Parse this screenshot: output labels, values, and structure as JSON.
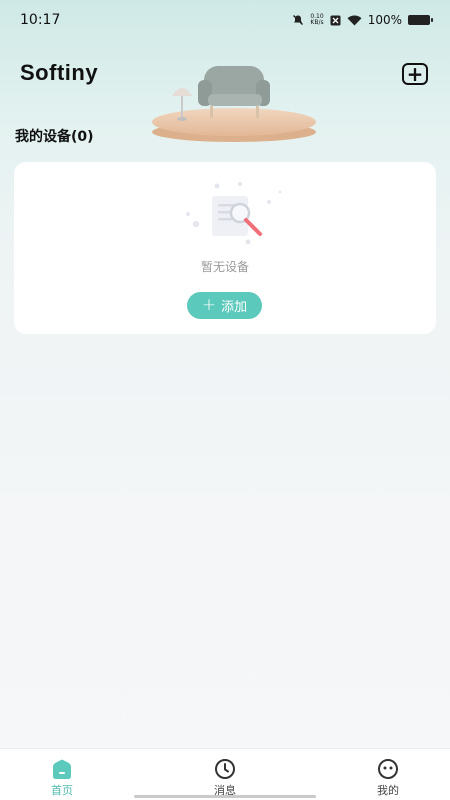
{
  "status_bar": {
    "time": "10:17",
    "net_speed_value": "0.10",
    "net_speed_unit": "KB/s",
    "battery": "100%"
  },
  "header": {
    "title": "Softiny",
    "add_icon": "plus-square-icon"
  },
  "devices_section": {
    "title": "我的设备(0)",
    "empty_text": "暂无设备",
    "add_button_label": "添加"
  },
  "tabbar": {
    "tabs": [
      {
        "label": "首页",
        "icon": "home-icon",
        "active": true
      },
      {
        "label": "消息",
        "icon": "clock-icon",
        "active": false
      },
      {
        "label": "我的",
        "icon": "face-icon",
        "active": false
      }
    ]
  },
  "colors": {
    "accent": "#5bc9bb",
    "active_tab": "#4fb9ad",
    "background_top": "#cfe9e6"
  }
}
